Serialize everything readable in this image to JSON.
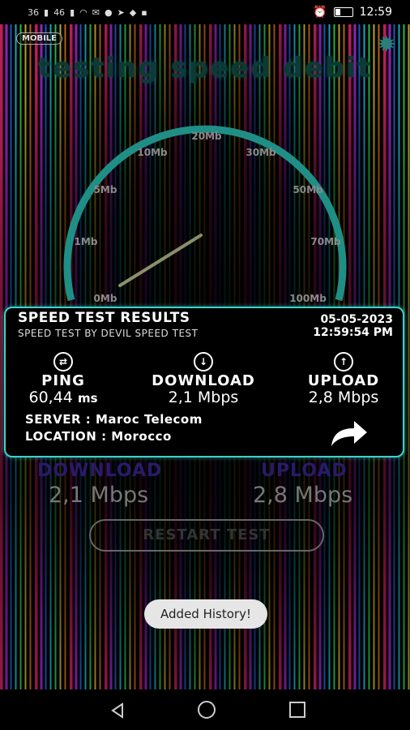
{
  "status_bar": {
    "signal_1": "36",
    "signal_2": "46",
    "time": "12:59"
  },
  "header": {
    "mobile_badge": "MOBILE",
    "title": "testing speed debit",
    "settings_icon": "gear-icon"
  },
  "gauge": {
    "tick_labels": [
      "0Mb",
      "1Mb",
      "5Mb",
      "10Mb",
      "20Mb",
      "30Mb",
      "50Mb",
      "70Mb",
      "100Mb"
    ],
    "accent_color": "#1f8f86"
  },
  "results": {
    "title": "SPEED TEST RESULTS",
    "subtitle": "SPEED TEST BY DEVIL SPEED TEST",
    "date": "05-05-2023",
    "time": "12:59:54 PM",
    "ping": {
      "label": "PING",
      "value": "60,44",
      "unit": "ms",
      "icon": "shuffle-icon"
    },
    "download": {
      "label": "DOWNLOAD",
      "value": "2,1 Mbps",
      "icon": "arrow-down-circle-icon"
    },
    "upload": {
      "label": "UPLOAD",
      "value": "2,8 Mbps",
      "icon": "arrow-up-circle-icon"
    },
    "server": "SERVER : Maroc Telecom",
    "location": "LOCATION : Morocco",
    "share_icon": "share-arrow-icon",
    "border_color": "#3fd0c8"
  },
  "summary": {
    "download_label": "DOWNLOAD",
    "download_value": "2,1 Mbps",
    "upload_label": "UPLOAD",
    "upload_value": "2,8 Mbps",
    "restart_label": "RESTART TEST"
  },
  "toast": {
    "message": "Added History!"
  }
}
